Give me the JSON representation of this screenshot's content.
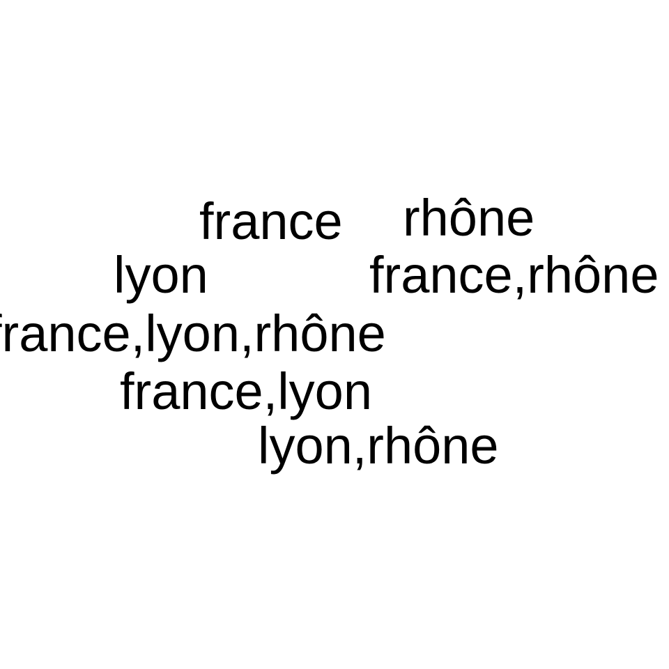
{
  "words": {
    "france": "france",
    "rhone": "rhône",
    "lyon": "lyon",
    "france_rhone": "france,rhône",
    "france_lyon_rhone": "france,lyon,rhône",
    "france_lyon": "france,lyon",
    "lyon_rhone": "lyon,rhône"
  },
  "colors": {
    "text": "#000000",
    "background": "#ffffff"
  }
}
